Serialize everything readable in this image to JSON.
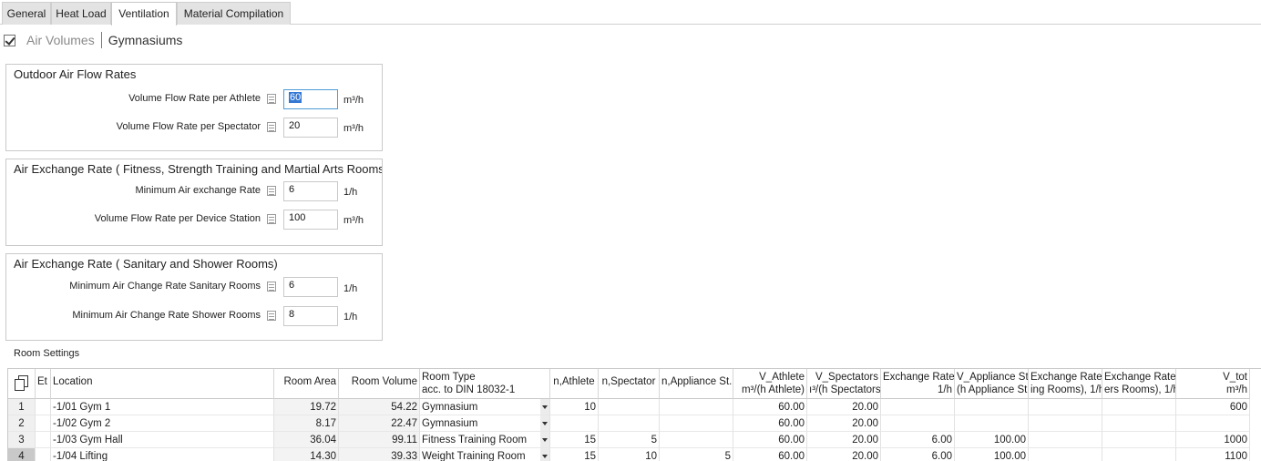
{
  "tabs": [
    {
      "label": "General",
      "active": false
    },
    {
      "label": "Heat Load",
      "active": false
    },
    {
      "label": "Ventilation",
      "active": true
    },
    {
      "label": "Material Compilation",
      "active": false
    }
  ],
  "header": {
    "checked": true,
    "title": "Air Volumes",
    "subtitle": "Gymnasiums"
  },
  "groups": [
    {
      "title": "Outdoor Air Flow Rates",
      "fields": [
        {
          "label": "Volume Flow Rate per Athlete",
          "value": "60",
          "unit": "m³/h",
          "focused": true
        },
        {
          "label": "Volume Flow Rate per Spectator",
          "value": "20",
          "unit": "m³/h",
          "focused": false
        }
      ]
    },
    {
      "title": "Air Exchange Rate ( Fitness, Strength Training and Martial Arts Rooms)",
      "fields": [
        {
          "label": "Minimum Air exchange Rate",
          "value": "6",
          "unit": "1/h",
          "focused": false
        },
        {
          "label": "Volume Flow Rate per Device Station",
          "value": "100",
          "unit": "m³/h",
          "focused": false
        }
      ]
    },
    {
      "title": "Air Exchange Rate ( Sanitary and Shower Rooms)",
      "fields": [
        {
          "label": "Minimum Air Change Rate Sanitary Rooms",
          "value": "6",
          "unit": "1/h",
          "focused": false
        },
        {
          "label": "Minimum Air Change Rate Shower Rooms",
          "value": "8",
          "unit": "1/h",
          "focused": false
        }
      ]
    }
  ],
  "room_settings": {
    "label": "Room Settings",
    "columns": [
      {
        "line1": "Et",
        "line2": ""
      },
      {
        "line1": "Location",
        "line2": ""
      },
      {
        "line1": "Room Area",
        "line2": ""
      },
      {
        "line1": "Room Volume",
        "line2": ""
      },
      {
        "line1": "Room Type",
        "line2": "acc. to DIN 18032-1"
      },
      {
        "line1": "n,Athlete",
        "line2": ""
      },
      {
        "line1": "n,Spectator",
        "line2": ""
      },
      {
        "line1": "n,Appliance St.",
        "line2": ""
      },
      {
        "line1": "V_Athlete",
        "line2": "m³/(h Athlete)"
      },
      {
        "line1": "V_Spectators",
        "line2": "ı³/(h Spectators)"
      },
      {
        "line1": "Exchange Rate",
        "line2": "1/h"
      },
      {
        "line1": "V_Appliance St.",
        "line2": "(h Appliance St.)"
      },
      {
        "line1": "Exchange Rate",
        "line2": "ing Rooms), 1/h"
      },
      {
        "line1": "Exchange Rate",
        "line2": "ers Rooms), 1/h"
      },
      {
        "line1": "V_tot",
        "line2": "m³/h"
      }
    ],
    "rows": [
      {
        "n": "1",
        "et": "",
        "location": "-1/01 Gym 1",
        "area": "19.72",
        "volume": "54.22",
        "type": "Gymnasium",
        "n_athlete": "10",
        "n_spectator": "",
        "n_appliance": "",
        "v_athlete": "60.00",
        "v_spectators": "20.00",
        "exchange_rate": "",
        "v_appliance": "",
        "exch_sanitary": "",
        "exch_shower": "",
        "v_tot": "600"
      },
      {
        "n": "2",
        "et": "",
        "location": "-1/02 Gym 2",
        "area": "8.17",
        "volume": "22.47",
        "type": "Gymnasium",
        "n_athlete": "",
        "n_spectator": "",
        "n_appliance": "",
        "v_athlete": "60.00",
        "v_spectators": "20.00",
        "exchange_rate": "",
        "v_appliance": "",
        "exch_sanitary": "",
        "exch_shower": "",
        "v_tot": ""
      },
      {
        "n": "3",
        "et": "",
        "location": "-1/03 Gym Hall",
        "area": "36.04",
        "volume": "99.11",
        "type": "Fitness Training Room",
        "n_athlete": "15",
        "n_spectator": "5",
        "n_appliance": "",
        "v_athlete": "60.00",
        "v_spectators": "20.00",
        "exchange_rate": "6.00",
        "v_appliance": "100.00",
        "exch_sanitary": "",
        "exch_shower": "",
        "v_tot": "1000"
      },
      {
        "n": "4",
        "et": "",
        "location": "-1/04 Lifting",
        "area": "14.30",
        "volume": "39.33",
        "type": "Weight Training Room",
        "n_athlete": "15",
        "n_spectator": "10",
        "n_appliance": "5",
        "v_athlete": "60.00",
        "v_spectators": "20.00",
        "exchange_rate": "6.00",
        "v_appliance": "100.00",
        "exch_sanitary": "",
        "exch_shower": "",
        "v_tot": "1100"
      }
    ]
  }
}
